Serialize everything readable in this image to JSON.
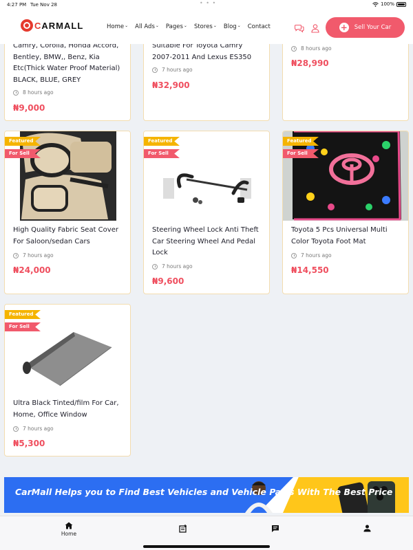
{
  "status_bar": {
    "time": "4:27 PM",
    "date": "Tue Nov 28",
    "battery": "100%"
  },
  "header": {
    "logo": {
      "mark": "C",
      "text": "ARMALL"
    },
    "nav": [
      {
        "label": "Home",
        "dropdown": true
      },
      {
        "label": "All Ads",
        "dropdown": true
      },
      {
        "label": "Pages",
        "dropdown": true
      },
      {
        "label": "Stores",
        "dropdown": true
      },
      {
        "label": "Blog",
        "dropdown": true
      },
      {
        "label": "Contact",
        "dropdown": false
      }
    ],
    "sell_button": "Sell Your Car",
    "icons": [
      "chat-icon",
      "user-icon"
    ],
    "accent_color": "#f15a6c"
  },
  "listings": [
    {
      "title": "Camry, Corolla, Honda Accord, Bentley, BMW,, Benz, Kia Etc(Thick Water Proof Material) BLACK, BLUE, GREY",
      "time": "8 hours ago",
      "price": "₦9,000",
      "featured": null,
      "for_sell": null
    },
    {
      "title": "Suitable For Toyota Camry 2007-2011 And Lexus ES350",
      "time": "7 hours ago",
      "price": "₦32,900",
      "featured": null,
      "for_sell": null
    },
    {
      "title": "",
      "time": "8 hours ago",
      "price": "₦28,990",
      "featured": null,
      "for_sell": null
    },
    {
      "title": "High Quality Fabric Seat Cover For Saloon/sedan Cars",
      "time": "7 hours ago",
      "price": "₦24,000",
      "featured": "Featured",
      "for_sell": "For Sell",
      "image": "seat-cover"
    },
    {
      "title": "Steering Wheel Lock Anti Theft Car Steering Wheel And Pedal Lock",
      "time": "7 hours ago",
      "price": "₦9,600",
      "featured": "Featured",
      "for_sell": "For Sell",
      "image": "steering-lock"
    },
    {
      "title": "Toyota 5 Pcs Universal Multi Color Toyota Foot Mat",
      "time": "7 hours ago",
      "price": "₦14,550",
      "featured": "Featured",
      "for_sell": "For Sell",
      "image": "foot-mat"
    },
    {
      "title": "Ultra Black Tinted/film For Car, Home, Office Window",
      "time": "7 hours ago",
      "price": "₦5,300",
      "featured": "Featured",
      "for_sell": "For Sell",
      "image": "tint-film"
    }
  ],
  "banner": {
    "text": "CarMall Helps you to Find Best Vehicles and Vehicle Parts With The Best Price"
  },
  "tabbar": [
    {
      "label": "Home",
      "icon": "home-icon",
      "active": true
    },
    {
      "label": "",
      "icon": "post-ad-icon"
    },
    {
      "label": "",
      "icon": "messages-icon"
    },
    {
      "label": "",
      "icon": "profile-icon"
    }
  ]
}
